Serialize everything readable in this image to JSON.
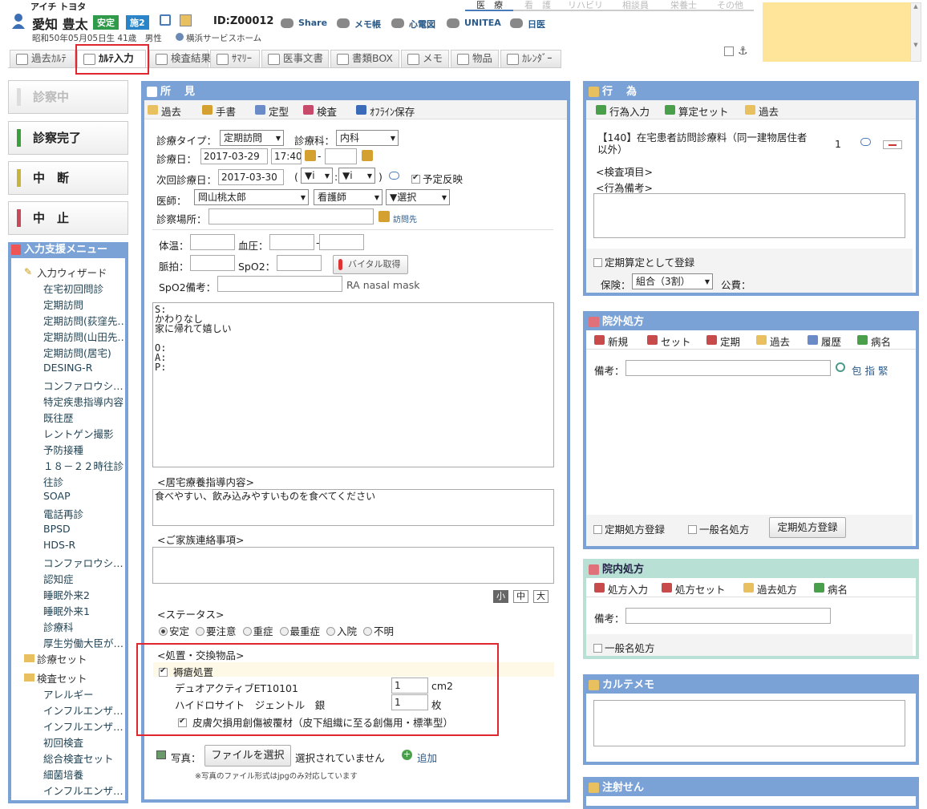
{
  "patient": {
    "kana": "アイチ トヨタ",
    "name": "愛知 豊太",
    "badge1": "安定",
    "badge2": "施2",
    "id": "ID:Z00012",
    "info": "昭和50年05月05日生 41歳　男性",
    "facility": "横浜サービスホーム"
  },
  "header_links": [
    "Share",
    "メモ帳",
    "心電図",
    "UNITEA",
    "日医"
  ],
  "top_tabs": [
    "医　療",
    "看　護",
    "リハビリ",
    "相談員",
    "栄養士",
    "その他"
  ],
  "tabs": [
    "過去ｶﾙﾃ",
    "ｶﾙﾃ入力",
    "検査結果",
    "ｻﾏﾘｰ",
    "医事文書",
    "書類BOX",
    "メモ",
    "物品",
    "ｶﾚﾝﾀﾞｰ"
  ],
  "side_buttons": [
    "診察中",
    "診察完了",
    "中　断",
    "中　止"
  ],
  "colors": {
    "accent": "#7aa2d6",
    "highlight": "#e0262e",
    "sticky": "#ffe59a",
    "done": "#3aa13a",
    "pause": "#c8b43c",
    "stop": "#c84a5a"
  },
  "menu": {
    "title": "入力支援メニュー",
    "wizard": "入力ウィザード",
    "wizard_items": [
      "在宅初回問診",
      "定期訪問",
      "定期訪問(荻窪先…",
      "定期訪問(山田先…",
      "定期訪問(居宅)",
      "DESING-R",
      "コンファロウシ…",
      "特定疾患指導内容",
      "既往歴",
      "レントゲン撮影",
      "予防接種",
      "１８－２２時往診",
      "往診",
      "SOAP",
      "電話再診",
      "BPSD",
      "HDS-R",
      "コンファロウシ…",
      "認知症",
      "睡眠外来2",
      "睡眠外来1",
      "診療科",
      "厚生労働大臣が…"
    ],
    "set": "診療セット",
    "exam_set": "検査セット",
    "exam_items": [
      "アレルギー",
      "インフルエンザ…",
      "インフルエンザ…",
      "初回検査",
      "総合検査セット",
      "細菌培養",
      "インフルエンザ…"
    ]
  },
  "findings": {
    "title": "所　見",
    "toolbar": [
      "過去",
      "手書",
      "定型",
      "検査",
      "ｵﾌﾗｲﾝ保存"
    ],
    "type_label": "診療タイプ：",
    "type_value": "定期訪問",
    "dept_label": "診療科：",
    "dept_value": "内科",
    "date_label": "診療日：",
    "date_value": "2017-03-29",
    "time_value": "17:40",
    "next_label": "次回診療日：",
    "next_value": "2017-03-30",
    "sel_a": "▼i",
    "sel_b": "▼i",
    "reflect_label": "予定反映",
    "doctor_label": "医師：",
    "doctor_value": "岡山桃太郎",
    "nurse_value": "看護師",
    "choice_value": "▼選択",
    "place_label": "診察場所：",
    "place_link": "訪問先",
    "temp_label": "体温：",
    "bp_label": "血圧：",
    "pulse_label": "脈拍：",
    "spo2_label": "SpO2：",
    "vital_btn": "バイタル取得",
    "spo2note_label": "SpO2備考：",
    "spo2note_hint": "RA nasal mask",
    "soap": "S:\nかわりなし\n家に帰れて嬉しい\n\nO:\nA:\nP:",
    "home_label": "<居宅療養指導内容>",
    "home_text": "食べやすい、飲み込みやすいものを食べてください",
    "family_label": "<ご家族連絡事項>",
    "sizes": [
      "小",
      "中",
      "大"
    ],
    "status_label": "<ステータス>",
    "status_options": [
      "安定",
      "要注意",
      "重症",
      "最重症",
      "入院",
      "不明"
    ],
    "treat_label": "<処置・交換物品>",
    "treat_item": "褥瘡処置",
    "item1_name": "デュオアクティブET10101",
    "item1_qty": "1",
    "item1_unit": "cm2",
    "item2_name": "ハイドロサイト　ジェントル　銀",
    "item2_qty": "1",
    "item2_unit": "枚",
    "item3": "皮膚欠損用創傷被覆材（皮下組織に至る創傷用・標準型）",
    "photo_label": "写真：",
    "file_btn": "ファイルを選択",
    "file_none": "選択されていません",
    "add": "追加",
    "photo_note": "※写真のファイル形式はjpgのみ対応しています"
  },
  "acts": {
    "title": "行　為",
    "toolbar": [
      "行為入力",
      "算定セット",
      "過去"
    ],
    "item": "【140】在宅患者訪問診療料（同一建物居住者\n以外）",
    "item_qty": "1",
    "exam": "<検査項目>",
    "note": "<行為備考>",
    "regular": "定期算定として登録",
    "ins_label": "保険：",
    "ins_value": "組合（3割）",
    "pub_label": "公費："
  },
  "outside": {
    "title": "院外処方",
    "toolbar": [
      "新規",
      "セット",
      "定期",
      "過去",
      "履歴",
      "病名"
    ],
    "note_label": "備考：",
    "links": "包 指 緊",
    "regular": "定期処方登録",
    "generic": "一般名処方",
    "btn": "定期処方登録"
  },
  "inside": {
    "title": "院内処方",
    "toolbar": [
      "処方入力",
      "処方セット",
      "過去処方",
      "病名"
    ],
    "note_label": "備考：",
    "generic": "一般名処方"
  },
  "memo": {
    "title": "カルテメモ"
  },
  "inject": {
    "title": "注射せん"
  }
}
